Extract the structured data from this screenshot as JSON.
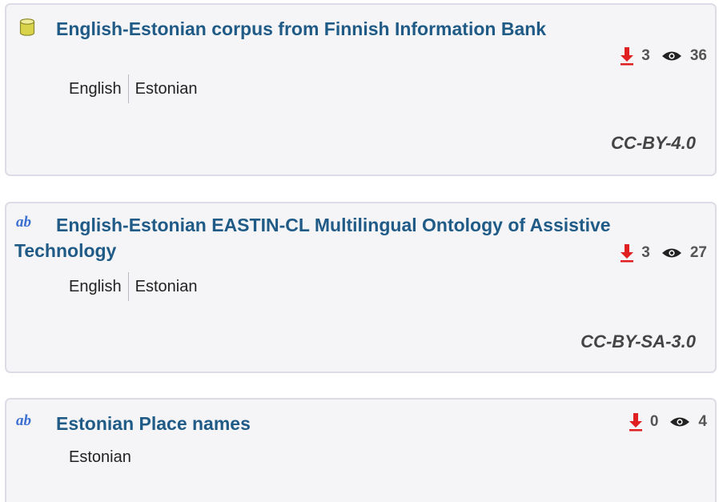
{
  "resources": [
    {
      "icon": "database-icon",
      "title": "English-Estonian corpus from Finnish Information Bank",
      "downloads": "3",
      "views": "36",
      "languages": [
        "English",
        "Estonian"
      ],
      "license": "CC-BY-4.0"
    },
    {
      "icon": "ab-lexical-icon",
      "icon_text": "ab",
      "title": "English-Estonian EASTIN-CL Multilingual Ontology of Assistive Technology",
      "downloads": "3",
      "views": "27",
      "languages": [
        "English",
        "Estonian"
      ],
      "license": "CC-BY-SA-3.0"
    },
    {
      "icon": "ab-lexical-icon",
      "icon_text": "ab",
      "title": "Estonian Place names",
      "downloads": "0",
      "views": "4",
      "languages": [
        "Estonian"
      ],
      "license": ""
    }
  ],
  "colors": {
    "title": "#1f5b86",
    "download_icon": "#e02020",
    "card_bg": "#f5f5f7",
    "card_border": "#dcdce6"
  }
}
